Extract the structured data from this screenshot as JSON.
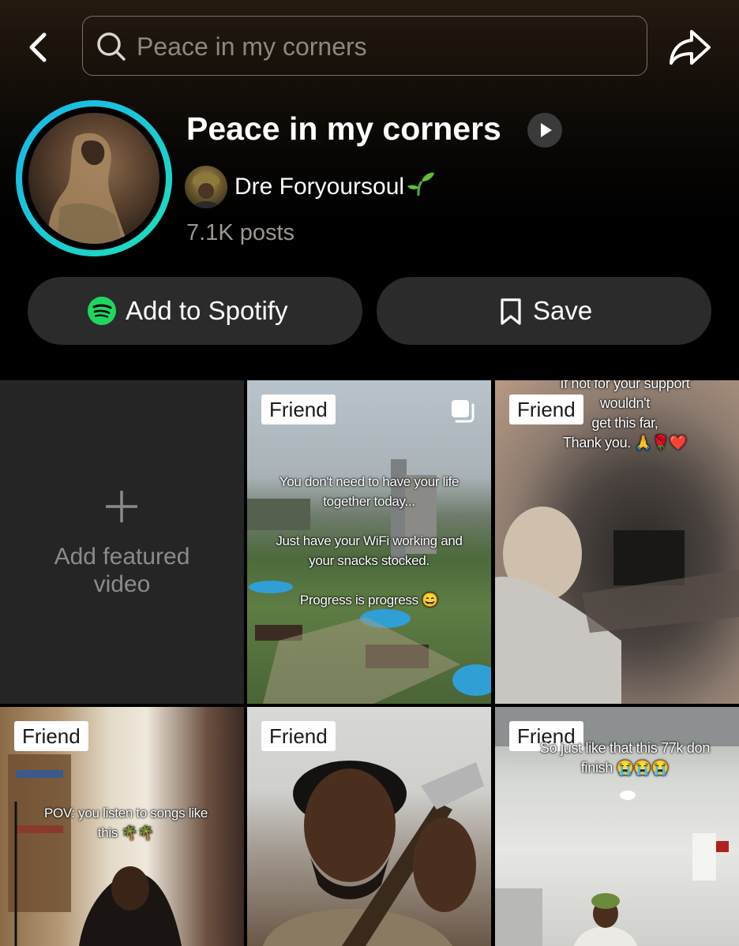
{
  "header": {
    "search_placeholder": "Peace in my corners"
  },
  "playlist": {
    "title": "Peace in my corners",
    "creator": "Dre Foryoursoul",
    "posts": "7.1K posts"
  },
  "actions": {
    "spotify_label": "Add to Spotify",
    "save_label": "Save"
  },
  "grid": {
    "featured_label": "Add featured\nvideo",
    "tiles": [
      {
        "badge": "Friend",
        "overlay": "You don't need to have your life\ntogether today...\n\nJust have your WiFi working and\nyour snacks stocked.\n\nProgress is progress 😄"
      },
      {
        "badge": "Friend",
        "overlay": "If not for your support\nwouldn't\nget this far,\nThank you. 🙏🌹❤️"
      },
      {
        "badge": "Friend",
        "overlay": "POV: you listen to songs like\nthis 🌴🌴"
      },
      {
        "badge": "Friend",
        "overlay": ""
      },
      {
        "badge": "Friend",
        "overlay": "So just like that this 77k don\nfinish 😭😭😭"
      }
    ]
  },
  "colors": {
    "spotify_green": "#1ed760",
    "ring_start": "#1bb6e8",
    "ring_end": "#20e0b8",
    "button_bg": "#2b2b2b"
  }
}
